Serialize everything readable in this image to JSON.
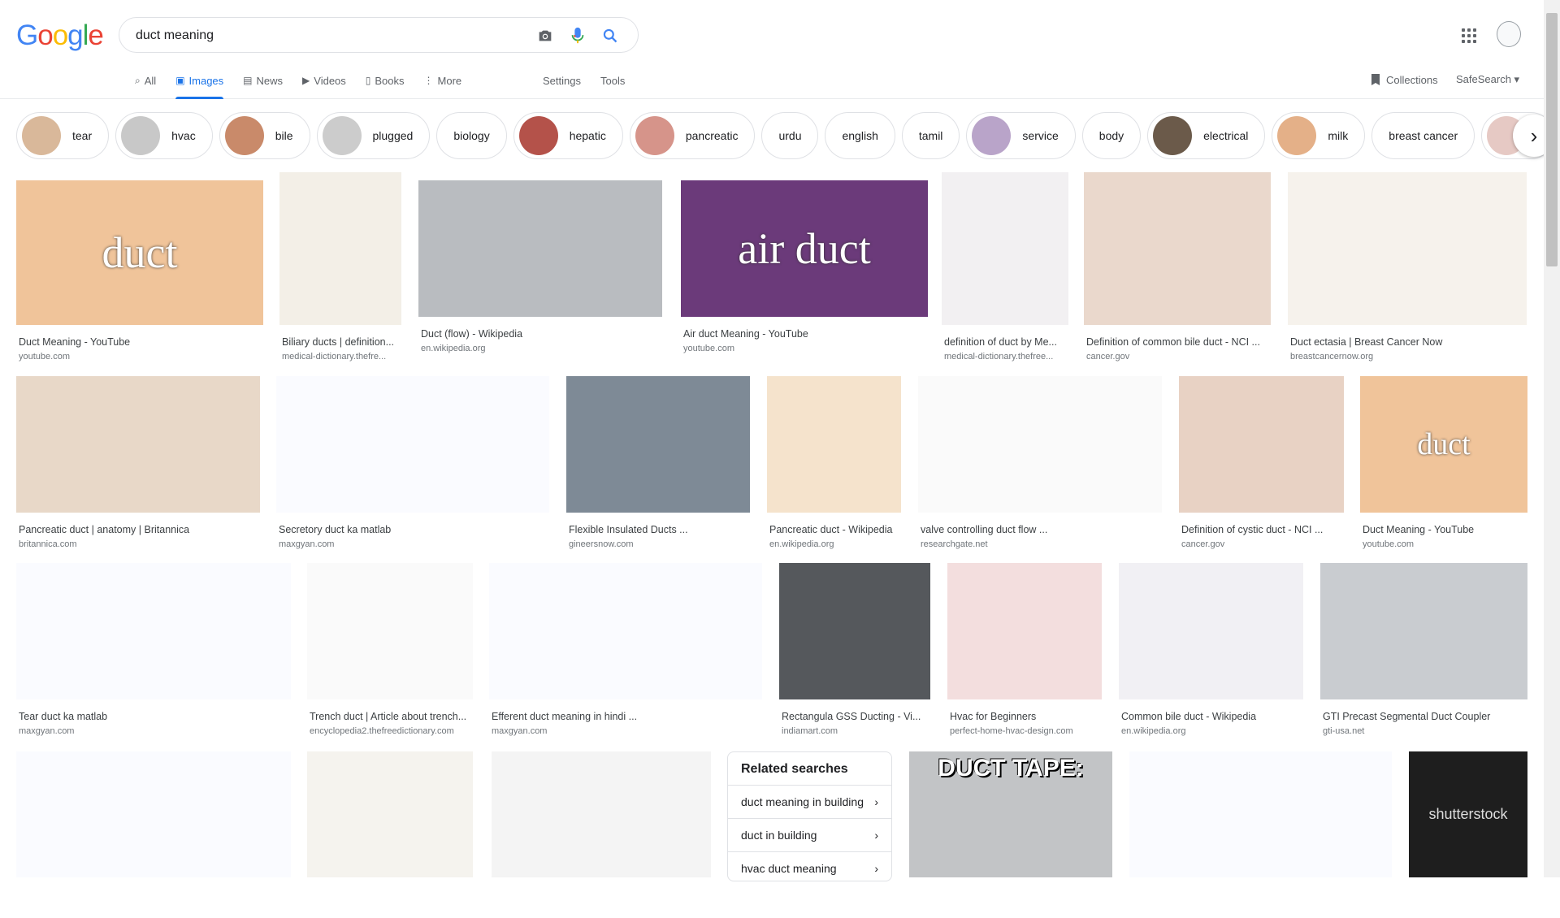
{
  "logo": {
    "letters": [
      "G",
      "o",
      "o",
      "g",
      "l",
      "e"
    ],
    "colors": [
      "#4285f4",
      "#ea4335",
      "#fbbc05",
      "#4285f4",
      "#34a853",
      "#ea4335"
    ]
  },
  "search": {
    "value": "duct meaning"
  },
  "nav": {
    "tabs": [
      {
        "label": "All",
        "icon": "search-icon"
      },
      {
        "label": "Images",
        "icon": "image-icon"
      },
      {
        "label": "News",
        "icon": "news-icon"
      },
      {
        "label": "Videos",
        "icon": "video-icon"
      },
      {
        "label": "Books",
        "icon": "book-icon"
      },
      {
        "label": "More",
        "icon": "more-vert-icon"
      }
    ],
    "settings": "Settings",
    "tools": "Tools",
    "collections": "Collections",
    "safesearch": "SafeSearch ▾"
  },
  "chips": [
    "tear",
    "hvac",
    "bile",
    "plugged",
    "biology",
    "hepatic",
    "pancreatic",
    "urdu",
    "english",
    "tamil",
    "service",
    "body",
    "electrical",
    "milk",
    "breast cancer",
    ""
  ],
  "results": [
    {
      "title": "Duct Meaning - YouTube",
      "site": "youtube.com",
      "thumb_text": "duct"
    },
    {
      "title": "Biliary ducts | definition...",
      "site": "medical-dictionary.thefre...",
      "thumb_text": ""
    },
    {
      "title": "Duct (flow) - Wikipedia",
      "site": "en.wikipedia.org",
      "thumb_text": ""
    },
    {
      "title": "Air duct Meaning - YouTube",
      "site": "youtube.com",
      "thumb_text": "air duct"
    },
    {
      "title": "definition of duct by Me...",
      "site": "medical-dictionary.thefree...",
      "thumb_text": ""
    },
    {
      "title": "Definition of common bile duct - NCI ...",
      "site": "cancer.gov",
      "thumb_text": ""
    },
    {
      "title": "Duct ectasia | Breast Cancer Now",
      "site": "breastcancernow.org",
      "thumb_text": ""
    },
    {
      "title": "Pancreatic duct | anatomy | Britannica",
      "site": "britannica.com",
      "thumb_text": ""
    },
    {
      "title": "Secretory duct ka matlab",
      "site": "maxgyan.com",
      "thumb_text": ""
    },
    {
      "title": "Flexible Insulated Ducts ...",
      "site": "gineersnow.com",
      "thumb_text": ""
    },
    {
      "title": "Pancreatic duct - Wikipedia",
      "site": "en.wikipedia.org",
      "thumb_text": ""
    },
    {
      "title": "valve controlling duct flow ...",
      "site": "researchgate.net",
      "thumb_text": ""
    },
    {
      "title": "Definition of cystic duct - NCI ...",
      "site": "cancer.gov",
      "thumb_text": ""
    },
    {
      "title": "Duct Meaning - YouTube",
      "site": "youtube.com",
      "thumb_text": "duct"
    },
    {
      "title": "Tear duct ka matlab",
      "site": "maxgyan.com",
      "thumb_text": ""
    },
    {
      "title": "Trench duct | Article about trench...",
      "site": "encyclopedia2.thefreedictionary.com",
      "thumb_text": ""
    },
    {
      "title": "Efferent duct meaning in hindi ...",
      "site": "maxgyan.com",
      "thumb_text": ""
    },
    {
      "title": "Rectangula GSS Ducting - Vi...",
      "site": "indiamart.com",
      "thumb_text": ""
    },
    {
      "title": "Hvac for Beginners",
      "site": "perfect-home-hvac-design.com",
      "thumb_text": ""
    },
    {
      "title": "Common bile duct - Wikipedia",
      "site": "en.wikipedia.org",
      "thumb_text": ""
    },
    {
      "title": "GTI Precast Segmental Duct Coupler",
      "site": "gti-usa.net",
      "thumb_text": ""
    },
    {
      "title": "",
      "site": "",
      "thumb_text": ""
    },
    {
      "title": "",
      "site": "",
      "thumb_text": ""
    },
    {
      "title": "",
      "site": "",
      "thumb_text": ""
    },
    {
      "title": "",
      "site": "",
      "thumb_text": "DUCT TAPE:"
    },
    {
      "title": "",
      "site": "",
      "thumb_text": ""
    },
    {
      "title": "",
      "site": "",
      "thumb_text": "shutterstock"
    }
  ],
  "related": {
    "heading": "Related searches",
    "items": [
      "duct meaning in building",
      "duct in building",
      "hvac duct meaning"
    ]
  }
}
